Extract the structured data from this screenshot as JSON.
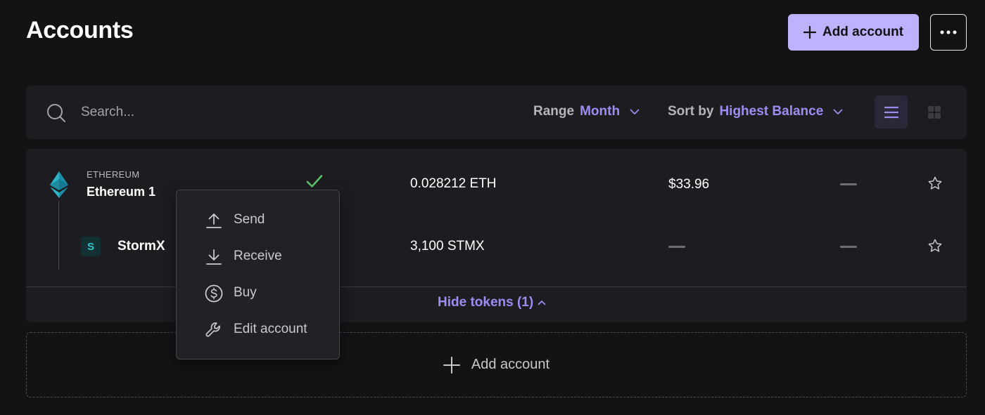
{
  "header": {
    "title": "Accounts",
    "add_account_label": "Add account"
  },
  "toolbar": {
    "search_placeholder": "Search...",
    "range_label": "Range",
    "range_value": "Month",
    "sort_label": "Sort by",
    "sort_value": "Highest Balance",
    "active_view": "list"
  },
  "account": {
    "network": "ETHEREUM",
    "name": "Ethereum 1",
    "balance": "0.028212 ETH",
    "fiat_value": "$33.96",
    "synced": true,
    "tokens": [
      {
        "badge": "S",
        "name": "StormX",
        "balance": "3,100 STMX"
      }
    ],
    "hide_tokens_label": "Hide tokens (1)"
  },
  "context_menu": {
    "items": [
      {
        "label": "Send",
        "icon": "upload-icon"
      },
      {
        "label": "Receive",
        "icon": "download-icon"
      },
      {
        "label": "Buy",
        "icon": "dollar-circle-icon"
      },
      {
        "label": "Edit account",
        "icon": "wrench-icon"
      }
    ]
  },
  "footer": {
    "add_account_label": "Add account"
  },
  "colors": {
    "background": "#131316",
    "panel": "#1d1d21",
    "accent": "#9f8cf2",
    "primary_button": "#bfb1fb",
    "success": "#5ec26a",
    "token_teal": "#30c4c8"
  }
}
